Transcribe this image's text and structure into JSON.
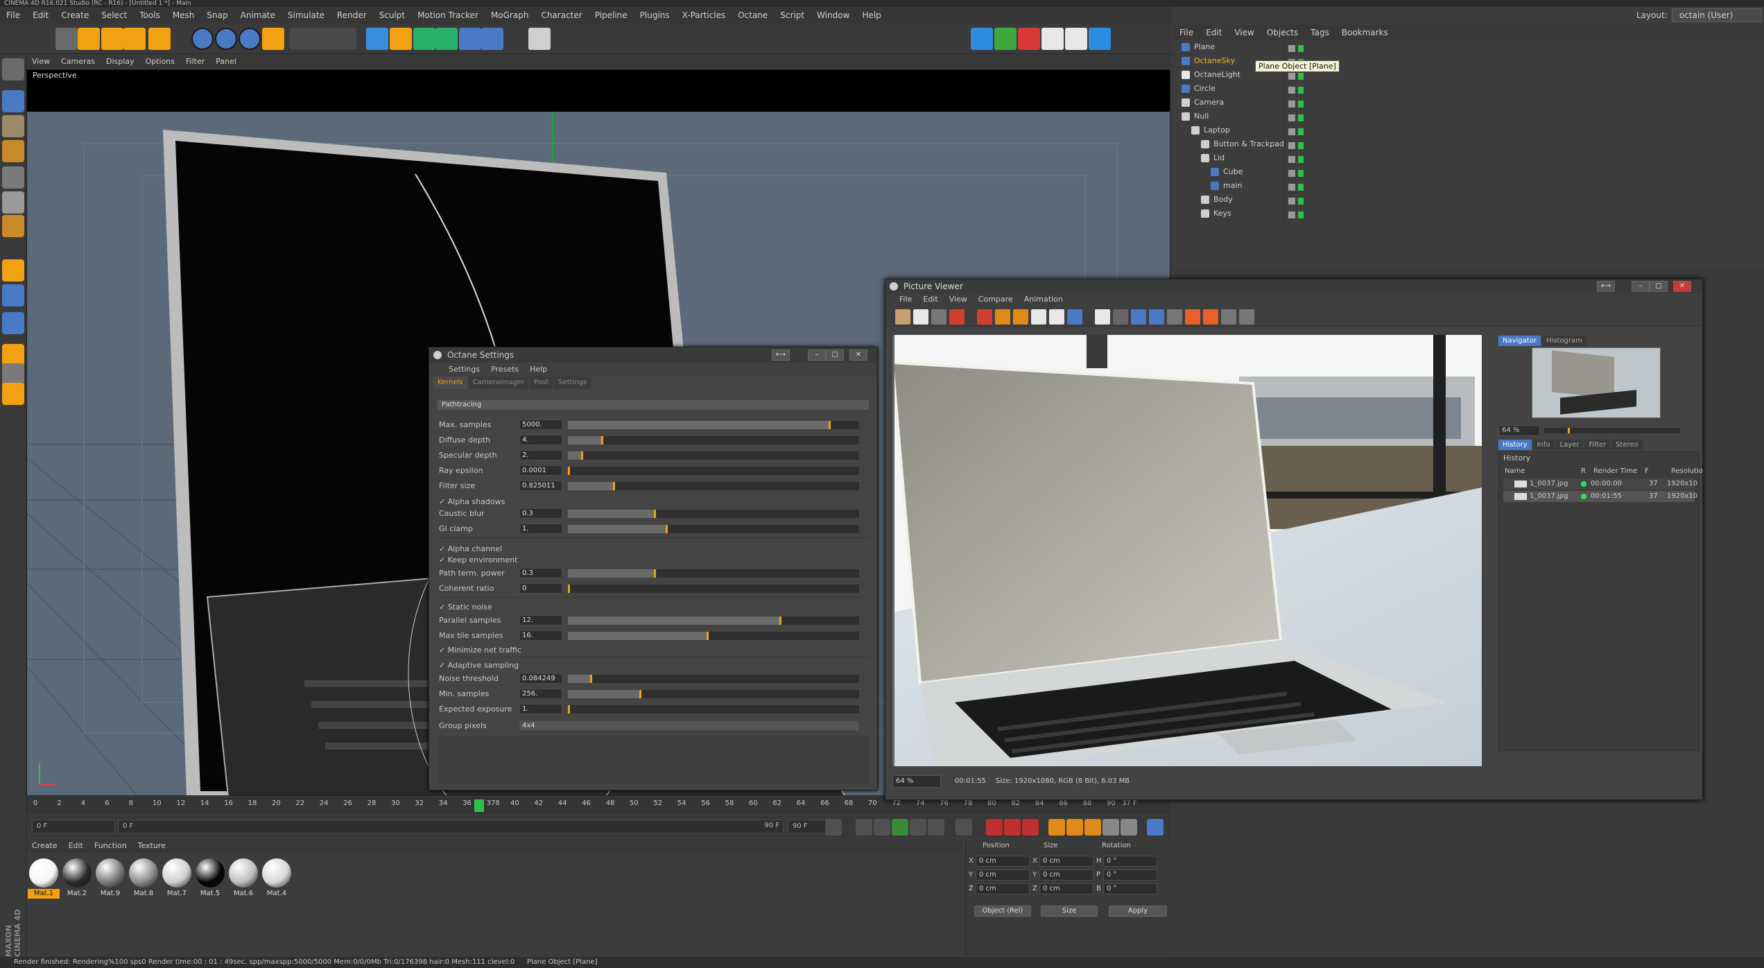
{
  "window": {
    "title": "CINEMA 4D R16.021 Studio (RC - R16) - [Untitled 1 *] - Main"
  },
  "menubar": [
    "File",
    "Edit",
    "Create",
    "Select",
    "Tools",
    "Mesh",
    "Snap",
    "Animate",
    "Simulate",
    "Render",
    "Sculpt",
    "Motion Tracker",
    "MoGraph",
    "Character",
    "Pipeline",
    "Plugins",
    "X-Particles",
    "Octane",
    "Script",
    "Window",
    "Help"
  ],
  "layout": {
    "label": "Layout:",
    "value": "octain (User)"
  },
  "toolbar": [
    "undo-icon",
    "live-select-icon",
    "move-icon",
    "scale-icon",
    "rotate-icon",
    "recent-tools-icon",
    "x-axis-icon",
    "y-axis-icon",
    "z-axis-icon",
    "world-coords-icon",
    "render-view-icon",
    "render-pv-icon",
    "render-settings-icon",
    "cube-icon",
    "pen-icon",
    "subdivision-icon",
    "array-icon",
    "deformer-icon",
    "floor-icon",
    "camera-icon",
    "light-icon",
    "octane-live-icon",
    "octane-settings-icon",
    "octane-render-icon",
    "octane-material-icon",
    "octane-hdri-icon",
    "octane-logo-icon"
  ],
  "lefttools": [
    "make-editable-icon",
    "model-mode-icon",
    "texture-mode-icon",
    "workplane-icon",
    "points-mode-icon",
    "edges-mode-icon",
    "polygons-mode-icon",
    "axis-icon",
    "tweak-icon",
    "solo-icon",
    "snap-icon",
    "grid-icon",
    "quantize-icon"
  ],
  "viewport": {
    "menu": [
      "View",
      "Cameras",
      "Display",
      "Options",
      "Filter",
      "Panel"
    ],
    "label": "Perspective"
  },
  "objects": {
    "menu": [
      "File",
      "Edit",
      "View",
      "Objects",
      "Tags",
      "Bookmarks"
    ],
    "items": [
      {
        "name": "Plane",
        "indent": 0,
        "highlight": false
      },
      {
        "name": "OctaneSky",
        "indent": 0,
        "highlight": true
      },
      {
        "name": "OctaneLight",
        "indent": 0,
        "highlight": false
      },
      {
        "name": "Circle",
        "indent": 0,
        "highlight": false
      },
      {
        "name": "Camera",
        "indent": 0,
        "highlight": false
      },
      {
        "name": "Null",
        "indent": 0,
        "highlight": false
      },
      {
        "name": "Laptop",
        "indent": 1,
        "highlight": false
      },
      {
        "name": "Button & Trackpad",
        "indent": 2,
        "highlight": false
      },
      {
        "name": "Lid",
        "indent": 2,
        "highlight": false
      },
      {
        "name": "Cube",
        "indent": 3,
        "highlight": false
      },
      {
        "name": "main",
        "indent": 3,
        "highlight": false
      },
      {
        "name": "Body",
        "indent": 2,
        "highlight": false
      },
      {
        "name": "Keys",
        "indent": 2,
        "highlight": false
      }
    ],
    "tooltip": "Plane Object [Plane]"
  },
  "timeline": {
    "ticks": [
      "0",
      "2",
      "4",
      "6",
      "8",
      "10",
      "12",
      "14",
      "16",
      "18",
      "20",
      "22",
      "24",
      "26",
      "28",
      "30",
      "32",
      "34",
      "36",
      "378",
      "40",
      "42",
      "44",
      "46",
      "48",
      "50",
      "52",
      "54",
      "56",
      "58",
      "60",
      "62",
      "64",
      "66",
      "68",
      "70",
      "72",
      "74",
      "76",
      "78",
      "80",
      "82",
      "84",
      "86",
      "88",
      "90"
    ],
    "current": 37,
    "end_field": "37 F"
  },
  "playbar": {
    "start": "0 F",
    "min": "0 F",
    "max": "90 F",
    "end": "90 F"
  },
  "materials": {
    "menu": [
      "Create",
      "Edit",
      "Function",
      "Texture"
    ],
    "items": [
      {
        "name": "Mat.1",
        "selected": true,
        "color": "#f4f4f4"
      },
      {
        "name": "Mat.2",
        "selected": false,
        "color": "#2a2a2a"
      },
      {
        "name": "Mat.9",
        "selected": false,
        "color": "#7a7a7a"
      },
      {
        "name": "Mat.8",
        "selected": false,
        "color": "#8a8a8a"
      },
      {
        "name": "Mat.7",
        "selected": false,
        "color": "#cfcfcf"
      },
      {
        "name": "Mat.5",
        "selected": false,
        "color": "#050505"
      },
      {
        "name": "Mat.6",
        "selected": false,
        "color": "#bdbdbd"
      },
      {
        "name": "Mat.4",
        "selected": false,
        "color": "#d8d8d8"
      }
    ]
  },
  "coords": {
    "headers": [
      "Position",
      "Size",
      "Rotation"
    ],
    "rows": [
      {
        "axis": "X",
        "pos": "0 cm",
        "saxis": "X",
        "size": "0 cm",
        "raxis": "H",
        "rot": "0 °"
      },
      {
        "axis": "Y",
        "pos": "0 cm",
        "saxis": "Y",
        "size": "0 cm",
        "raxis": "P",
        "rot": "0 °"
      },
      {
        "axis": "Z",
        "pos": "0 cm",
        "saxis": "Z",
        "size": "0 cm",
        "raxis": "B",
        "rot": "0 °"
      }
    ],
    "mode": "Object (Rel)",
    "sizemode": "Size",
    "apply": "Apply"
  },
  "status": {
    "text": "Render finished: Rendering%100 sps0 Render time:00 : 01 : 49sec. spp/maxspp:5000/5000 Mem:0/0/0Mb Tri:0/176398 hair:0 Mesh:111 clevel:0",
    "right": "Plane Object [Plane]",
    "brand": "MAXON CINEMA 4D"
  },
  "octane": {
    "title": "Octane Settings",
    "menu": [
      "Settings",
      "Presets",
      "Help"
    ],
    "tabs": [
      "Kernels",
      "CameraImager",
      "Post",
      "Settings"
    ],
    "kernel": "Pathtracing",
    "params": [
      {
        "label": "Max. samples",
        "value": "5000.",
        "frac": 0.9
      },
      {
        "label": "Diffuse depth",
        "value": "4.",
        "frac": 0.12
      },
      {
        "label": "Specular depth",
        "value": "2.",
        "frac": 0.05
      },
      {
        "label": "Ray epsilon",
        "value": "0.0001",
        "frac": 0.0
      },
      {
        "label": "Filter size",
        "value": "0.825011",
        "frac": 0.16
      },
      {
        "label": "Caustic blur",
        "value": "0.3",
        "frac": 0.3
      },
      {
        "label": "GI clamp",
        "value": "1.",
        "frac": 0.34
      },
      {
        "label": "Path term. power",
        "value": "0.3",
        "frac": 0.3
      },
      {
        "label": "Coherent ratio",
        "value": "0",
        "frac": 0.0
      },
      {
        "label": "Parallel samples",
        "value": "12.",
        "frac": 0.73
      },
      {
        "label": "Max tile samples",
        "value": "16.",
        "frac": 0.48
      },
      {
        "label": "Noise threshold",
        "value": "0.084249",
        "frac": 0.08
      },
      {
        "label": "Min. samples",
        "value": "256.",
        "frac": 0.25
      },
      {
        "label": "Expected exposure",
        "value": "1.",
        "frac": 0.0
      }
    ],
    "checks": [
      "Alpha shadows",
      "Alpha channel",
      "Keep environment",
      "Static noise",
      "Minimize net traffic",
      "Adaptive sampling"
    ],
    "group_label": "Group pixels",
    "group_value": "4x4"
  },
  "pv": {
    "title": "Picture Viewer",
    "menu": [
      "File",
      "Edit",
      "View",
      "Compare",
      "Animation"
    ],
    "status_zoom": "64 %",
    "status_time": "00:01:55",
    "status_size": "Size: 1920x1080, RGB (8 Bit), 6.03 MB",
    "nav_tabs": [
      "Navigator",
      "Histogram"
    ],
    "nav_zoom": "64 %",
    "hist_tabs": [
      "History",
      "Info",
      "Layer",
      "Filter",
      "Stereo"
    ],
    "hist_title": "History",
    "hist_headers": [
      "Name",
      "R",
      "Render Time",
      "F",
      "Resolutio"
    ],
    "hist_rows": [
      {
        "name": "1_0037.jpg",
        "time": "00:00:00",
        "frame": "37",
        "res": "1920x10"
      },
      {
        "name": "1_0037.jpg",
        "time": "00:01:55",
        "frame": "37",
        "res": "1920x10"
      }
    ]
  },
  "colors": {
    "accent": "#f2a112",
    "select": "#4a79c5",
    "green": "#2fc24b"
  }
}
